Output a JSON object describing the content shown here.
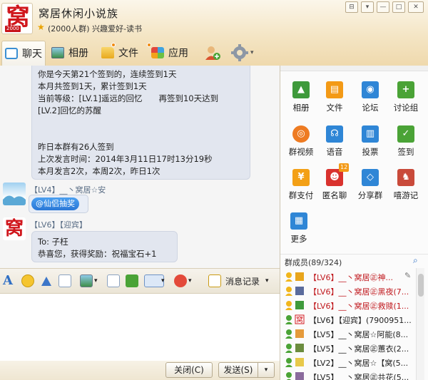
{
  "header": {
    "logo_glyph": "窝",
    "logo_year": "2000",
    "group_name": "窝居休闲小说族",
    "group_sub": "(2000人群) 兴趣爱好-读书",
    "window_controls": [
      "⊟",
      "▾",
      "—",
      "□",
      "✕"
    ]
  },
  "tabs": [
    {
      "label": "聊天",
      "icon": "chat-icon"
    },
    {
      "label": "相册",
      "icon": "photo-icon"
    },
    {
      "label": "文件",
      "icon": "folder-icon"
    },
    {
      "label": "应用",
      "icon": "apps-icon"
    }
  ],
  "chat": {
    "checkin_lines": [
      "你是今天第21个签到的，连续签到1天",
      "本月共签到1天，累计签到1天",
      "当前等级：[LV.1]遥远的回忆　　再签到10天达到",
      "[LV.2]回忆的苏醒",
      "昨日本群有26人签到",
      "上次发言时间：2014年3月11日17时13分19秒",
      "本月发言2次，本周2次，昨日1次"
    ],
    "msg2": {
      "sender": "【LV4】__丶窝居☆安",
      "card": "@仙侣抽奖"
    },
    "msg3": {
      "sender": "【LV6】【迎宾】",
      "lines": [
        "To: 子枉",
        "恭喜您，获得奖励：祝福宝石+1"
      ]
    }
  },
  "toolbar": {
    "history_label": "消息记录"
  },
  "buttons": {
    "close_label": "关闭(C)",
    "send_label": "发送(S)"
  },
  "apps": [
    {
      "label": "相册",
      "color": "#3e9a3b",
      "glyph": "▲",
      "icon": "album-icon"
    },
    {
      "label": "文件",
      "color": "#f39a16",
      "glyph": "▤",
      "icon": "file-icon"
    },
    {
      "label": "论坛",
      "color": "#2f86d6",
      "glyph": "◉",
      "icon": "forum-icon"
    },
    {
      "label": "讨论组",
      "color": "#4aa336",
      "glyph": "+",
      "icon": "discussion-icon"
    },
    {
      "label": "群视频",
      "color": "#ee7b22",
      "glyph": "◎",
      "icon": "video-icon"
    },
    {
      "label": "语音",
      "color": "#2f86d6",
      "glyph": "☊",
      "icon": "voice-icon"
    },
    {
      "label": "投票",
      "color": "#2f86d6",
      "glyph": "▥",
      "icon": "vote-icon"
    },
    {
      "label": "签到",
      "color": "#4aa336",
      "glyph": "✓",
      "icon": "checkin-icon"
    },
    {
      "label": "群支付",
      "color": "#f3a016",
      "glyph": "¥",
      "icon": "pay-icon"
    },
    {
      "label": "匿名聊",
      "color": "#d9322e",
      "glyph": "☻",
      "icon": "anonymous-icon",
      "badge": "12"
    },
    {
      "label": "分享群",
      "color": "#2f86d6",
      "glyph": "◇",
      "icon": "share-icon"
    },
    {
      "label": "嘻游记",
      "color": "#c94a3a",
      "glyph": "♞",
      "icon": "game-icon"
    },
    {
      "label": "更多",
      "color": "#2f86d6",
      "glyph": "▦",
      "icon": "more-icon"
    }
  ],
  "members": {
    "title": "群成员(89/324)",
    "rows": [
      {
        "lv": "【LV6】",
        "name": "__丶窝居㊣神...",
        "color": "#c0171c"
      },
      {
        "lv": "【LV6】",
        "name": "__丶窝居㊣黑夜(7...",
        "color": "#c0171c"
      },
      {
        "lv": "【LV6】",
        "name": "__丶窝居㊣救赎(1...",
        "color": "#c0171c"
      },
      {
        "lv": "【LV6】",
        "name": "【迎宾】(7900951...",
        "color": "#222222"
      },
      {
        "lv": "【LV5】",
        "name": "__丶窝居☆阿能(8...",
        "color": "#222222"
      },
      {
        "lv": "【LV5】",
        "name": "__丶窝居㊣蕙衣(2...",
        "color": "#222222"
      },
      {
        "lv": "【LV2】",
        "name": "__丶窝居☆【窝(5...",
        "color": "#222222"
      },
      {
        "lv": "【LV5】",
        "name": "__丶窝居㊣共花(5...",
        "color": "#222222"
      }
    ]
  }
}
